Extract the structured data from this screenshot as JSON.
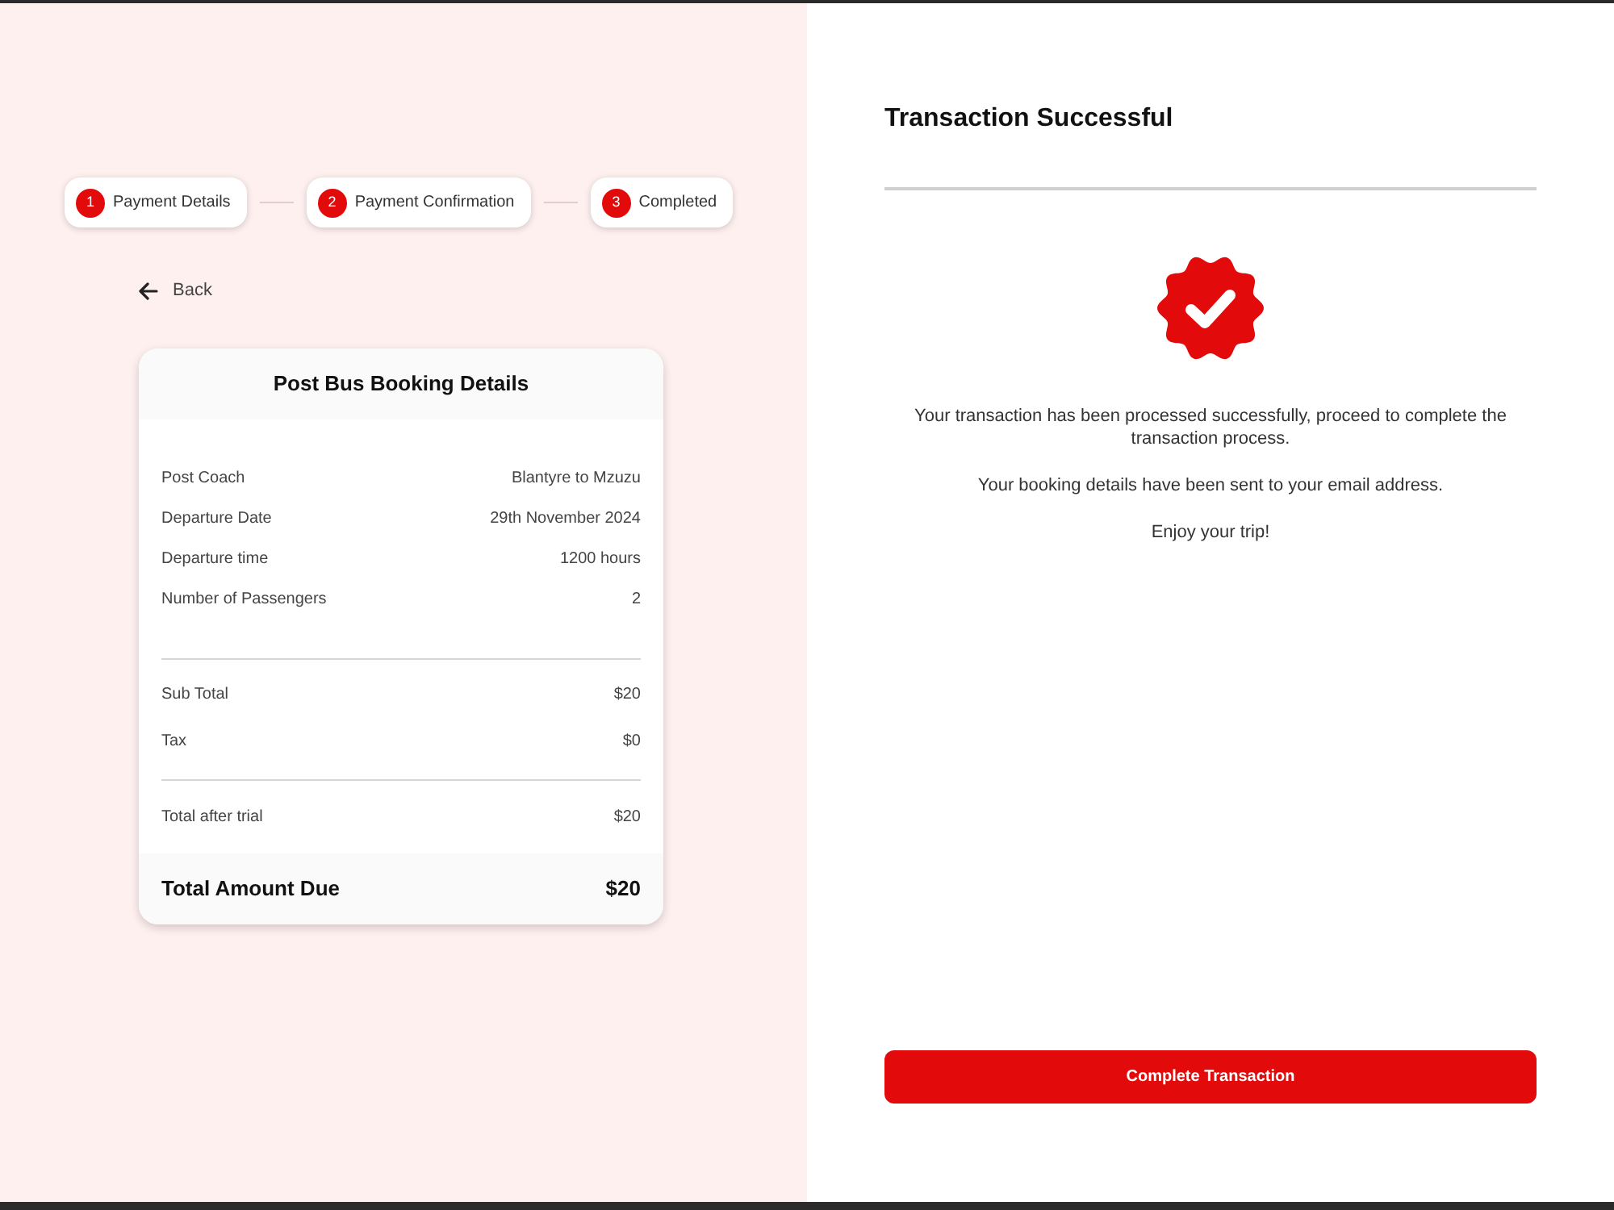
{
  "steps": [
    {
      "number": "1",
      "label": "Payment Details"
    },
    {
      "number": "2",
      "label": "Payment Confirmation"
    },
    {
      "number": "3",
      "label": "Completed"
    }
  ],
  "back_link": {
    "label": "Back"
  },
  "booking_card": {
    "title": "Post Bus Booking Details",
    "details": [
      {
        "label": "Post Coach",
        "value": "Blantyre to Mzuzu"
      },
      {
        "label": "Departure Date",
        "value": "29th November 2024"
      },
      {
        "label": "Departure time",
        "value": "1200 hours"
      },
      {
        "label": "Number of Passengers",
        "value": "2"
      }
    ],
    "charges": [
      {
        "label": "Sub Total",
        "value": "$20"
      },
      {
        "label": "Tax",
        "value": "$0"
      }
    ],
    "total_after_trial": {
      "label": "Total after trial",
      "value": "$20"
    },
    "total_due": {
      "label": "Total Amount Due",
      "value": "$20"
    }
  },
  "result_panel": {
    "title": "Transaction Successful",
    "messages": [
      "Your transaction has been processed successfully, proceed to complete the transaction process.",
      "Your booking details have been sent to your email address.",
      "Enjoy your trip!"
    ],
    "button": "Complete Transaction"
  }
}
